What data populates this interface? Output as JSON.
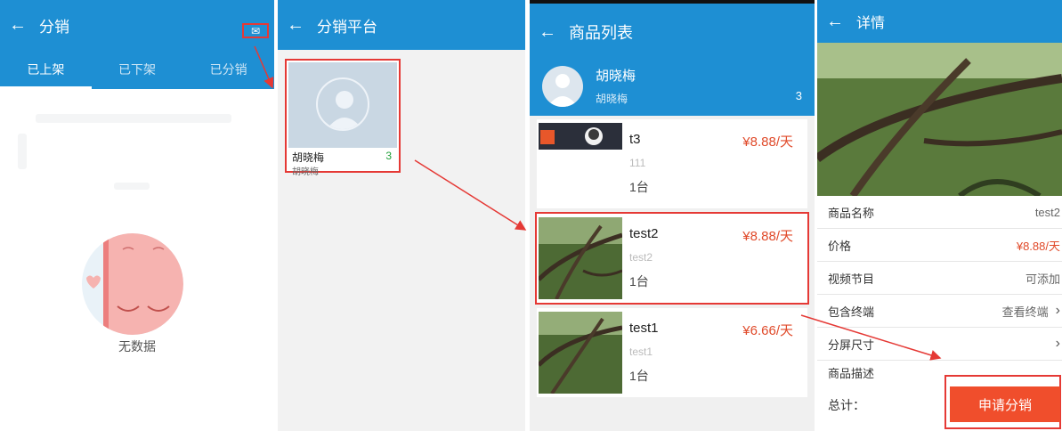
{
  "screen1": {
    "title": "分销",
    "back_icon": "←",
    "mail_icon": "✉",
    "tabs": [
      {
        "label": "已上架",
        "active": true
      },
      {
        "label": "已下架",
        "active": false
      },
      {
        "label": "已分销",
        "active": false
      }
    ],
    "empty_text": "无数据"
  },
  "screen2": {
    "title": "分销平台",
    "back_icon": "←",
    "card": {
      "name": "胡晓梅",
      "count": "3",
      "sub": "胡晓梅"
    }
  },
  "screen3": {
    "title": "商品列表",
    "back_icon": "←",
    "profile": {
      "name": "胡晓梅",
      "sub": "胡晓梅",
      "count": "3"
    },
    "items": [
      {
        "title": "t3",
        "sub": "111",
        "unit": "1台",
        "price": "¥8.88/天"
      },
      {
        "title": "test2",
        "sub": "test2",
        "unit": "1台",
        "price": "¥8.88/天"
      },
      {
        "title": "test1",
        "sub": "test1",
        "unit": "1台",
        "price": "¥6.66/天"
      }
    ]
  },
  "screen4": {
    "title": "详情",
    "back_icon": "←",
    "rows": [
      {
        "key": "商品名称",
        "value": "test2"
      },
      {
        "key": "价格",
        "value": "¥8.88/天"
      },
      {
        "key": "视频节目",
        "value": "可添加"
      },
      {
        "key": "包含终端",
        "value": "查看终端"
      },
      {
        "key": "分屏尺寸",
        "value": ""
      },
      {
        "key": "商品描述",
        "value": ""
      }
    ],
    "chevron": "›",
    "total_label": "总计：",
    "apply_label": "申请分销"
  },
  "colors": {
    "header_blue": "#1e8fd3",
    "price_red": "#e04a2a",
    "annotation_red": "#e53935",
    "count_green": "#21a03a"
  }
}
